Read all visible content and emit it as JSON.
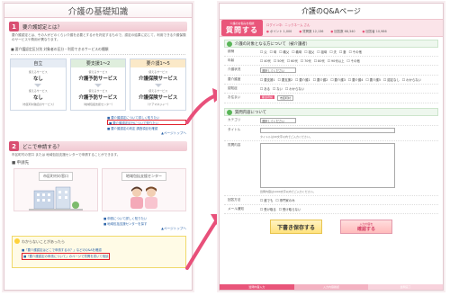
{
  "left": {
    "title": "介護の基礎知識",
    "sec1": {
      "num": "1",
      "label": "要介護認定とは？",
      "body": "要介護認定とは、その人がどのくらい介護を必要とするかを判定するもので、認定の結果に応じて、利用できる介護保険のサービスや費用が異なります。",
      "notice": "■ 要介護認定区分別 対象者の区分・利用できるサービスの種類",
      "boxes": [
        {
          "head": "自立",
          "sub": "使えるサービス",
          "main": "なし",
          "sub2": "使えるサービス",
          "main2": "なし",
          "foot": "（市区町村独自のサービス）"
        },
        {
          "head": "要支援1～2",
          "sub": "使えるサービス",
          "main": "介護予防サービス",
          "sub2": "使えるサービス",
          "main2": "介護予防サービス",
          "foot": "（地域包括支援センター）"
        },
        {
          "head": "要介護1～5",
          "sub": "使えるサービス",
          "main": "介護保険サービス",
          "sub2": "使えるサービス",
          "main2": "介護保険サービス",
          "foot": "（ケアマネジャー）"
        }
      ],
      "links": [
        "■ 要介護認定について詳しく知りたい",
        "■ 要介護認定区分について知りたい",
        "■ 要介護認定の判定 調査項目を確認"
      ],
      "totop": "▲ページトップへ"
    },
    "sec2": {
      "num": "2",
      "label": "どこで申請する？",
      "body": "市区町村の窓口 または 地域包括支援センターで申請することができます。",
      "notice": "■ 申請先",
      "places": [
        "市区町村の窓口",
        "地域包括支援センター"
      ],
      "links": [
        "■ 申請について詳しく知りたい",
        "■ 地域包括支援センターを探す"
      ],
      "totop": "▲ページトップへ"
    },
    "faq": {
      "question": "わからないことがあったら",
      "links": [
        "■「要介護認定はどこで申請するの？」などのQ&Aを確認",
        "■「要介護認定の申請について」のページで質問を書いて相談"
      ]
    }
  },
  "right": {
    "title": "介護のQ&Aページ",
    "badge_small": "介護のお悩みを相談",
    "badge_big": "質問する",
    "user_name": "ログイン中：ニックネーム さん",
    "stats": [
      "ポイント 1,000",
      "質問数 12,136",
      "回答数 68,340",
      "回答者 10,986"
    ],
    "sec1": "介護の対象となる方について（被介護者）",
    "rows": [
      {
        "label": "続柄",
        "opts": [
          "父",
          "母",
          "義父",
          "義母",
          "祖父",
          "祖母",
          "夫",
          "妻",
          "その他"
        ]
      },
      {
        "label": "年齢",
        "opts": [
          "40代",
          "50代",
          "60代",
          "70代",
          "80代",
          "90代以上",
          "その他"
        ]
      },
      {
        "label": "介護状況",
        "select": "選択してください"
      },
      {
        "label": "要介護度",
        "opts": [
          "要支援1",
          "要支援2",
          "要介護1",
          "要介護2",
          "要介護3",
          "要介護4",
          "要介護5",
          "認定なし",
          "わからない"
        ]
      },
      {
        "label": "認知症",
        "opts": [
          "ある",
          "ない",
          "わからない"
        ]
      },
      {
        "label": "お住まい",
        "tags": [
          "都道府県",
          "市区町村"
        ]
      }
    ],
    "sec2": "質問内容について",
    "q_rows": [
      {
        "label": "カテゴリ",
        "select": "選択してください"
      },
      {
        "label": "タイトル",
        "hint": "タイトルは40文字以内でご入力ください。"
      },
      {
        "label": "質問内容",
        "hint": "質問内容は1000文字以内でご入力ください。"
      },
      {
        "label": "回答方法",
        "opts": [
          "誰でも",
          "専門家のみ"
        ]
      },
      {
        "label": "メール通知",
        "opts": [
          "受け取る",
          "受け取らない"
        ]
      }
    ],
    "btn_draft": "下書き保存する",
    "btn_confirm_small": "入力内容を",
    "btn_confirm": "確認する",
    "steps": [
      "質問内容入力",
      "入力内容確認",
      "質問完了"
    ]
  }
}
